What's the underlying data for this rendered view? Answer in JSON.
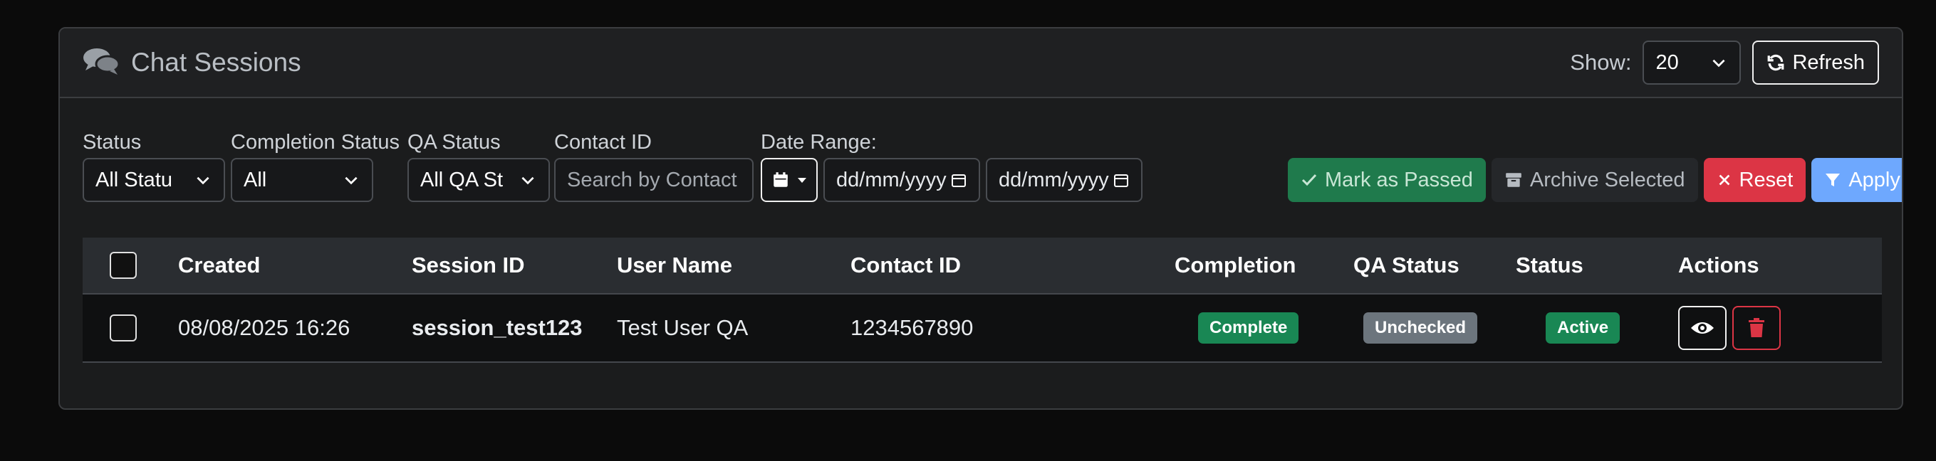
{
  "header": {
    "title": "Chat Sessions",
    "show_label": "Show:",
    "page_size": "20",
    "refresh_label": "Refresh"
  },
  "filters": {
    "status": {
      "label": "Status",
      "value": "All Statu"
    },
    "completion": {
      "label": "Completion Status",
      "value": "All"
    },
    "qa_status": {
      "label": "QA Status",
      "value": "All QA St"
    },
    "contact": {
      "label": "Contact ID",
      "placeholder": "Search by Contact"
    },
    "date_range": {
      "label": "Date Range:",
      "from": "dd/mm/yyyy",
      "to": "dd/mm/yyyy"
    }
  },
  "actions": {
    "mark_passed": "Mark as Passed",
    "archive": "Archive Selected",
    "reset": "Reset",
    "apply": "Apply"
  },
  "table": {
    "columns": {
      "created": "Created",
      "session_id": "Session ID",
      "user_name": "User Name",
      "contact_id": "Contact ID",
      "completion": "Completion",
      "qa_status": "QA Status",
      "status": "Status",
      "actions": "Actions"
    },
    "rows": [
      {
        "created": "08/08/2025 16:26",
        "session_id": "session_test123",
        "user_name": "Test User QA",
        "contact_id": "1234567890",
        "completion": "Complete",
        "qa_status": "Unchecked",
        "status": "Active"
      }
    ]
  },
  "colors": {
    "green": "#198754",
    "gray": "#6c757d",
    "red": "#dc3545",
    "blue": "#6ea8fe"
  },
  "icons": [
    "comments-icon",
    "refresh-icon",
    "chevron-down-icon",
    "calendar-icon",
    "check-icon",
    "archive-icon",
    "close-icon",
    "filter-icon",
    "eye-icon",
    "trash-icon"
  ]
}
